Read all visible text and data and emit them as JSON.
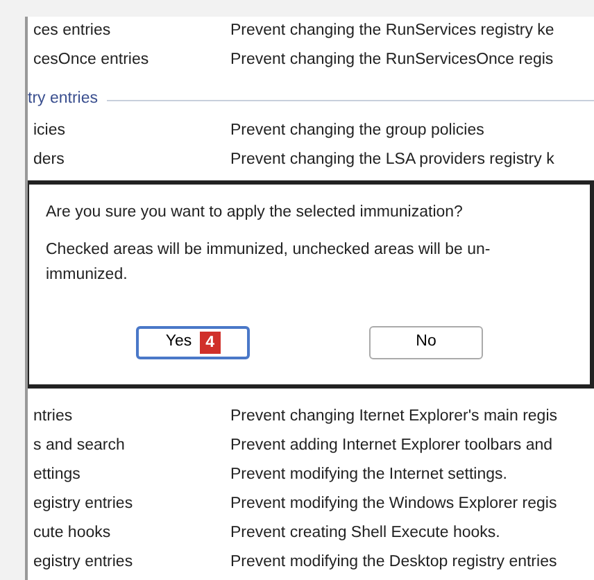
{
  "rows_above": [
    {
      "name": "ces entries",
      "description": "Prevent changing the RunServices registry ke"
    },
    {
      "name": "cesOnce entries",
      "description": "Prevent changing the RunServicesOnce regis"
    }
  ],
  "group": {
    "title": "try entries",
    "rows": [
      {
        "name": "icies",
        "description": "Prevent changing the group policies"
      },
      {
        "name": "ders",
        "description": "Prevent changing the LSA providers registry k"
      }
    ]
  },
  "dialog": {
    "question": "Are you sure you want to apply the selected immunization?",
    "note": "Checked areas will be immunized, unchecked areas will be un-immunized.",
    "buttons": [
      {
        "label": "Yes",
        "default": true,
        "badge": "4"
      },
      {
        "label": "No",
        "default": false
      }
    ]
  },
  "rows_below": [
    {
      "name": "ntries",
      "description": "Prevent changing Iternet Explorer's main regis"
    },
    {
      "name": "s and search",
      "description": "Prevent adding Internet Explorer toolbars and"
    },
    {
      "name": "ettings",
      "description": "Prevent modifying the Internet settings."
    },
    {
      "name": "egistry entries",
      "description": "Prevent modifying the Windows Explorer regis"
    },
    {
      "name": "cute hooks",
      "description": "Prevent creating Shell Execute hooks."
    },
    {
      "name": "egistry entries",
      "description": "Prevent modifying the Desktop registry entries"
    }
  ]
}
